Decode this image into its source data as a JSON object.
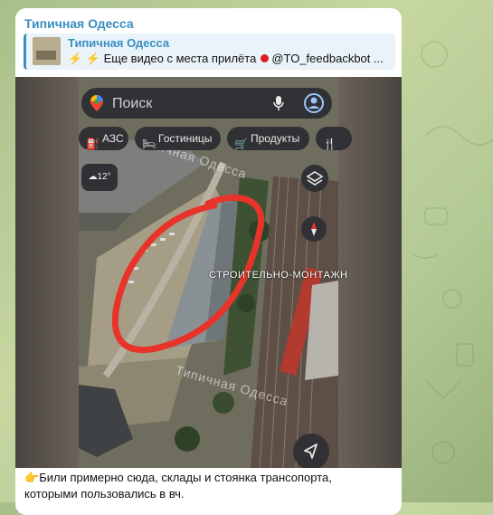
{
  "message": {
    "channel_name": "Типичная Одесса",
    "reply": {
      "title": "Типичная Одесса",
      "text_prefix": "⚡ ⚡ Еще видео с места прилёта",
      "text_suffix": "@TO_feedbackbot ..."
    },
    "caption_line1": "Били примерно сюда, склады и стоянка трансопорта,",
    "caption_line2": "которыми пользовались в вч."
  },
  "maps": {
    "search_placeholder": "Поиск",
    "chips": [
      "АЗС",
      "Гостиницы",
      "Продукты"
    ],
    "weather": "12°",
    "building_label": "СТРОИТЕЛЬНО-МОНТАЖН",
    "watermark": "Типичная Одесса"
  },
  "colors": {
    "accent": "#3a8fc0",
    "highlight_circle": "#e8332a",
    "app_dark": "#303134"
  },
  "icons": [
    "map-pin-icon",
    "microphone-icon",
    "account-icon",
    "gas-station-icon",
    "hotel-icon",
    "cart-icon",
    "restaurant-icon",
    "cloud-icon",
    "layers-icon",
    "compass-icon",
    "navigate-icon",
    "pointing-hand-icon"
  ]
}
